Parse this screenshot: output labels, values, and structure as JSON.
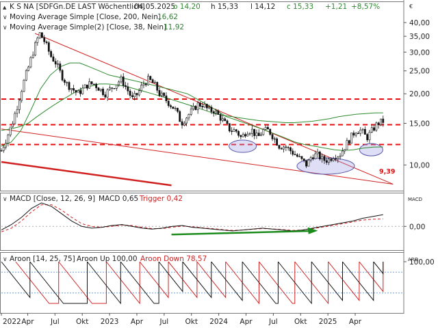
{
  "chart_data": [
    {
      "type": "candlestick",
      "name_line": "K S NA [SDFGn.DE LAST Wöchentlich]",
      "date": "04.05.2025",
      "ohlc": {
        "o_label": "o 14,20",
        "h_label": "h 15,33",
        "l_label": "l 14,12",
        "c_label": "c 15,33",
        "chg_label": "+1,21",
        "pct_label": "+8,57%"
      },
      "indicators": [
        {
          "label": "Moving Average Simple [Close, 200, Nein]",
          "value": "16,62",
          "color": "#2e7d32"
        },
        {
          "label": "Moving Average Simple(2) [Close, 38, Nein]",
          "value": "11,92",
          "color": "#2e7d32"
        }
      ],
      "currency": "€",
      "y_scale": "log",
      "ylim": [
        8.0,
        46.0
      ],
      "y_ticks": [
        {
          "v": 40,
          "label": "40,00"
        },
        {
          "v": 35,
          "label": "35,00"
        },
        {
          "v": 30,
          "label": "30,00"
        },
        {
          "v": 25,
          "label": "25,00"
        },
        {
          "v": 20,
          "label": "20,00"
        },
        {
          "v": 15,
          "label": "15,00"
        },
        {
          "v": 10,
          "label": "10,00"
        }
      ],
      "last_price_label": "9,39",
      "close_path": [
        11.5,
        13,
        15,
        18,
        22,
        26,
        31,
        36,
        33,
        29,
        27,
        24,
        22,
        21,
        20,
        21,
        22,
        22,
        21,
        20,
        21,
        22,
        23,
        21,
        19,
        20,
        22,
        23,
        22,
        20,
        19,
        18,
        17,
        15,
        16,
        17,
        18,
        18,
        17,
        17,
        16,
        15,
        14,
        14,
        13,
        14,
        14,
        13,
        14,
        14,
        13,
        12,
        12,
        11.5,
        11,
        10.5,
        10,
        11,
        11,
        10.5,
        10.5,
        11,
        11,
        12,
        13,
        14,
        14,
        13,
        14,
        15,
        15.3
      ],
      "ma200_path": [
        14,
        14.2,
        14.5,
        15,
        16,
        17,
        18,
        19,
        20,
        21,
        21.5,
        22,
        22,
        21.8,
        21.5,
        21,
        20.5,
        20,
        19.5,
        19,
        18.5,
        18,
        17.5,
        17,
        16.5,
        16.2,
        16,
        15.8,
        15.6,
        15.4,
        15.3,
        15.2,
        15.1,
        15.1,
        15.2,
        15.3,
        15.5,
        15.7,
        16,
        16.2,
        16.4,
        16.5,
        16.6,
        16.62
      ],
      "ma38_path": [
        12,
        12.5,
        14,
        17,
        21,
        24,
        26,
        27,
        27,
        26,
        25,
        24,
        23.5,
        23,
        22.5,
        22,
        21.5,
        21,
        20.5,
        20,
        19,
        18,
        17,
        16,
        15.5,
        15,
        14.5,
        14,
        13.5,
        13,
        12.5,
        12.2,
        12,
        11.8,
        11.6,
        11.5,
        11.6,
        11.8,
        11.9,
        11.92
      ],
      "resistance_levels": [
        19.0,
        14.8,
        12.2
      ]
    },
    {
      "type": "line",
      "title": "MACD [Close, 12, 26, 9]",
      "value_label": "MACD 0,65",
      "trigger_label": "Trigger 0,42",
      "panel_label": "MACD",
      "y_ticks": [
        {
          "v": 0,
          "label": "0,00"
        }
      ],
      "ylim": [
        -1.2,
        1.6
      ],
      "macd_path": [
        -0.2,
        0.1,
        0.5,
        1.0,
        1.3,
        1.1,
        0.7,
        0.3,
        0.0,
        -0.1,
        -0.05,
        0.05,
        0.1,
        0.0,
        -0.1,
        -0.15,
        -0.1,
        0.0,
        0.05,
        -0.05,
        -0.1,
        -0.15,
        -0.2,
        -0.25,
        -0.2,
        -0.15,
        -0.1,
        -0.15,
        -0.2,
        -0.25,
        -0.2,
        -0.1,
        0.0,
        0.1,
        0.2,
        0.3,
        0.45,
        0.55,
        0.65
      ],
      "trigger_path": [
        -0.3,
        -0.1,
        0.3,
        0.8,
        1.2,
        1.2,
        0.9,
        0.5,
        0.15,
        0.0,
        -0.05,
        0.0,
        0.08,
        0.05,
        -0.05,
        -0.12,
        -0.12,
        -0.05,
        0.02,
        -0.02,
        -0.08,
        -0.12,
        -0.18,
        -0.22,
        -0.2,
        -0.16,
        -0.12,
        -0.14,
        -0.18,
        -0.22,
        -0.2,
        -0.12,
        -0.04,
        0.05,
        0.15,
        0.25,
        0.35,
        0.4,
        0.42
      ]
    },
    {
      "type": "line",
      "title": "Aroon [14, 25, 75]",
      "up_label": "Aroon Up 100,00",
      "down_label": "Aroon Down 78,57",
      "panel_label": "ARO",
      "y_ticks": [
        {
          "v": 100,
          "label": "100,00"
        }
      ],
      "ylim": [
        0,
        100
      ],
      "levels": [
        75,
        25
      ],
      "up_sawtooth_starts": [
        0,
        12,
        36,
        50,
        66,
        76,
        88,
        101,
        116,
        130,
        143,
        156
      ],
      "down_sawtooth_starts": [
        6,
        24,
        44,
        58,
        70,
        82,
        94,
        108,
        123,
        137,
        150
      ]
    }
  ],
  "x_axis": {
    "ticks": [
      {
        "label": "2022",
        "x": 0.0
      },
      {
        "label": "Apr",
        "x": 0.0665
      },
      {
        "label": "Jul",
        "x": 0.1355
      },
      {
        "label": "Okt",
        "x": 0.2045
      },
      {
        "label": "2023",
        "x": 0.2735
      },
      {
        "label": "Apr",
        "x": 0.3425
      },
      {
        "label": "Jul",
        "x": 0.4115
      },
      {
        "label": "Okt",
        "x": 0.4805
      },
      {
        "label": "2024",
        "x": 0.5495
      },
      {
        "label": "Apr",
        "x": 0.6185
      },
      {
        "label": "Jul",
        "x": 0.6875
      },
      {
        "label": "Okt",
        "x": 0.7565
      },
      {
        "label": "2025",
        "x": 0.8255
      },
      {
        "label": "Apr",
        "x": 0.8945
      }
    ]
  }
}
